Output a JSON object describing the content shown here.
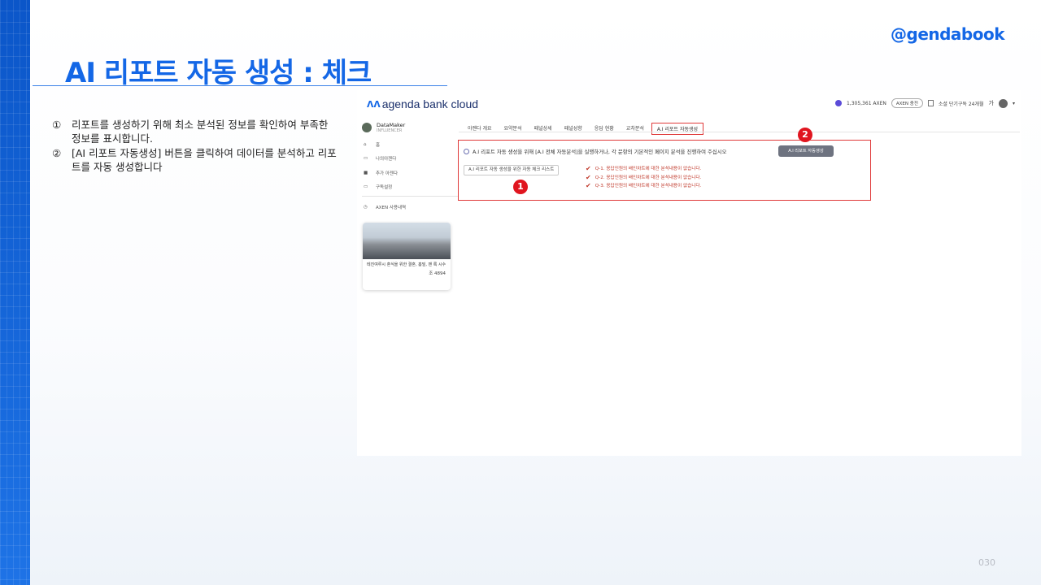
{
  "brand": "@gendabook",
  "slide": {
    "title": "AI 리포트 자동 생성 : 체크",
    "page_number": "030",
    "instructions": [
      {
        "num": "①",
        "text": "리포트를 생성하기 위해 최소 분석된 정보를 확인하여 부족한 정보를 표시합니다."
      },
      {
        "num": "②",
        "text": "[AI 리포트 자동생성] 버튼을 클릭하여 데이터를 분석하고 리포트를 자동 생성합니다"
      }
    ]
  },
  "app": {
    "logo_text": "agenda bank cloud",
    "header": {
      "balance": "1,305,361 AXEN",
      "charge_label": "AXEN 충전",
      "subscription": "소셜 단기구독 24개월",
      "lang": "가"
    },
    "profile": {
      "name": "DataMaker",
      "role": "INFLUENCER"
    },
    "sidebar_items": [
      "홈",
      "나의아젠다",
      "추가 아젠다",
      "구독설정",
      "AXEN 사용내역"
    ],
    "card": {
      "text": "테진여루시 혼식을 위한 결혼, 홈빌, 맨 록 시수",
      "count": "조 4894"
    },
    "tabs": [
      "아젠다 개요",
      "요약분석",
      "패널상세",
      "패널성향",
      "응답 현황",
      "교차분석",
      "A.I 리포트 자동생성"
    ],
    "panel": {
      "message": "A.I 리포트 자동 생성을 위해 [A.I 전체 자동분석]을 실행하거나, 각 문항의 기본적인 페이지 분석을 진행하여 주십시오",
      "generate_label": "A.I 리포트 자동생성",
      "checklist_label": "A.I 리포트 자동 생성을 위한 자동 체크 리스트",
      "checks": [
        "Q-1. 응답인원의 배인차트에 대한 분석내용이 없습니다.",
        "Q-2. 응답인원의 배인차트에 대한 분석내용이 없습니다.",
        "Q-3. 응답인원의 배인차트에 대한 분석내용이 없습니다."
      ]
    },
    "badges": [
      "1",
      "2"
    ]
  }
}
